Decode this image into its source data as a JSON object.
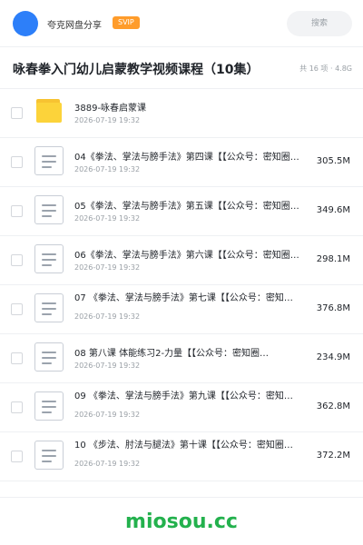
{
  "header": {
    "user_name": "夸克网盘分享",
    "badge": "SVIP",
    "search_placeholder": "搜索",
    "accent_color": "#2d7ff9"
  },
  "title_row": {
    "title": "咏春拳入门幼儿启蒙教学视频课程（10集）",
    "summary": "共 16 项 · 4.8G"
  },
  "items": [
    {
      "type": "folder",
      "name": "3889-咏春启蒙课",
      "date": "2026-07-19 19:32",
      "size": ""
    },
    {
      "type": "file",
      "name": "04《拳法、掌法与膀手法》第四课【【公众号：密知圈…",
      "date": "2026-07-19 19:32",
      "size": "305.5M"
    },
    {
      "type": "file",
      "name": "05《拳法、掌法与膀手法》第五课【【公众号：密知圈…",
      "date": "2026-07-19 19:32",
      "size": "349.6M"
    },
    {
      "type": "file",
      "name": "06《拳法、掌法与膀手法》第六课【【公众号：密知圈…",
      "date": "2026-07-19 19:32",
      "size": "298.1M"
    },
    {
      "type": "file",
      "name": "07 《拳法、掌法与膀手法》第七课【【公众号：密知…",
      "date": "2026-07-19 19:32",
      "size": "376.8M"
    },
    {
      "type": "file",
      "name": "08 第八课 体能练习2-力量【【公众号：密知圈…",
      "date": "2026-07-19 19:32",
      "size": "234.9M"
    },
    {
      "type": "file",
      "name": "09 《拳法、掌法与膀手法》第九课【【公众号：密知…",
      "date": "2026-07-19 19:32",
      "size": "362.8M"
    },
    {
      "type": "file",
      "name": "10 《步法、肘法与腿法》第十课【【公众号：密知圈…",
      "date": "2026-07-19 19:32",
      "size": "372.2M"
    }
  ],
  "watermark": "miosou.cc"
}
